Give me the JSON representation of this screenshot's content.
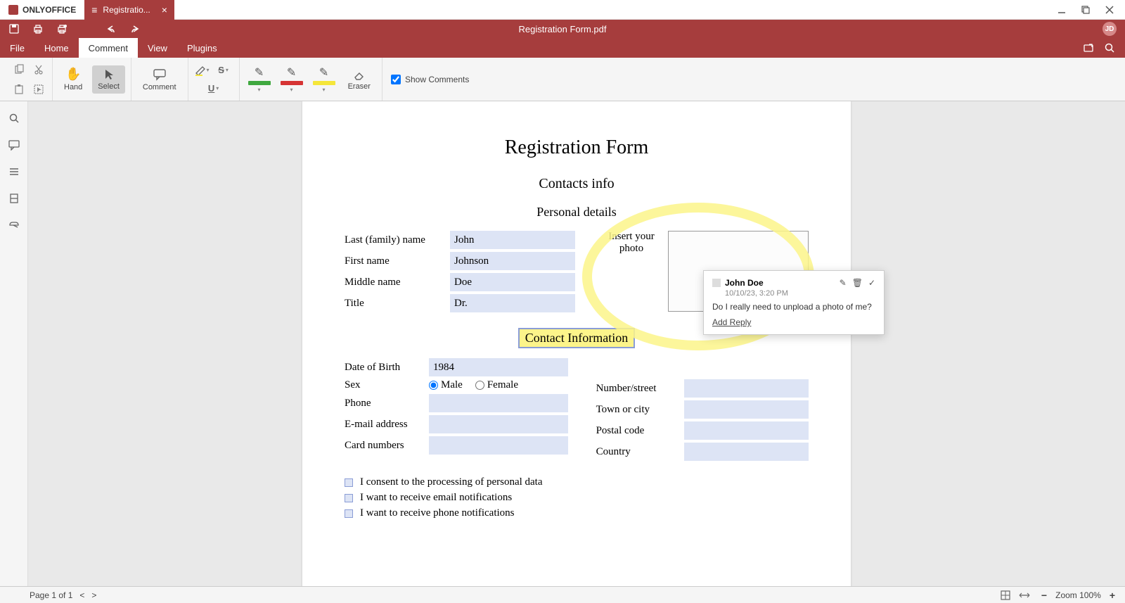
{
  "app": {
    "name": "ONLYOFFICE",
    "tab_title": "Registratio...",
    "doc_title": "Registration Form.pdf",
    "avatar_initials": "JD"
  },
  "menu": {
    "file": "File",
    "home": "Home",
    "comment": "Comment",
    "view": "View",
    "plugins": "Plugins"
  },
  "toolbar": {
    "hand": "Hand",
    "select": "Select",
    "comment": "Comment",
    "eraser": "Eraser",
    "show_comments": "Show Comments",
    "colors": {
      "green": "#3fa83f",
      "red": "#d63434",
      "yellow": "#f5e63a"
    }
  },
  "form": {
    "title": "Registration Form",
    "subtitle": "Contacts info",
    "section_personal": "Personal details",
    "last_name_label": "Last (family) name",
    "last_name": "John",
    "first_name_label": "First name",
    "first_name": "Johnson",
    "middle_name_label": "Middle name",
    "middle_name": "Doe",
    "title_label": "Title",
    "title_value": "Dr.",
    "photo_label": "Insert your photo",
    "section_contact": "Contact Information",
    "dob_label": "Date of Birth",
    "dob": "1984",
    "sex_label": "Sex",
    "male": "Male",
    "female": "Female",
    "phone_label": "Phone",
    "email_label": "E-mail address",
    "card_label": "Card numbers",
    "number_street_label": "Number/street",
    "town_label": "Town or city",
    "postal_label": "Postal code",
    "country_label": "Country",
    "consent": "I consent to the processing of personal data",
    "email_notif": "I want to receive email notifications",
    "phone_notif": "I want to receive phone notifications"
  },
  "comment_popup": {
    "author": "John Doe",
    "date": "10/10/23, 3:20 PM",
    "body": "Do I really need to unpload a photo of me?",
    "add_reply": "Add Reply"
  },
  "status": {
    "page_text": "Page 1 of 1",
    "zoom_text": "Zoom 100%"
  }
}
